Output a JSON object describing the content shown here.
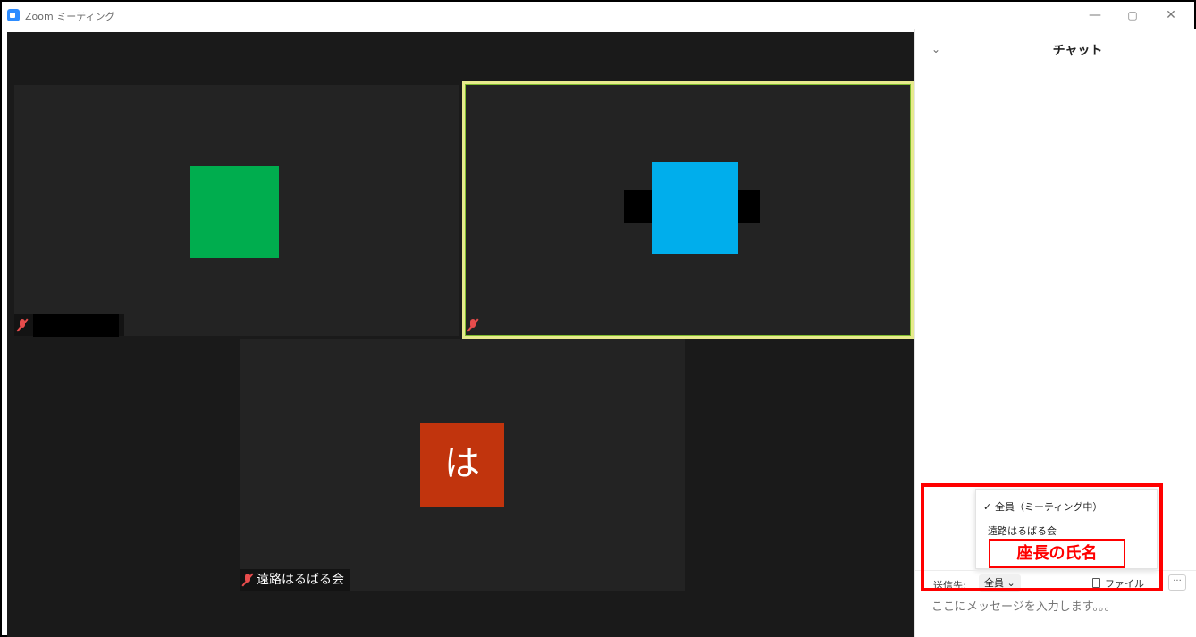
{
  "window": {
    "title": "Zoom ミーティング",
    "minimize_glyph": "—",
    "maximize_glyph": "▢",
    "close_glyph": "✕"
  },
  "participants": [
    {
      "avatar_color": "#00ad4e",
      "name_redacted": true
    },
    {
      "avatar_color": "#00aeec",
      "active_speaker": true
    },
    {
      "avatar_color": "#c1340d",
      "avatar_text": "は",
      "name": "遠路はるばる会"
    }
  ],
  "chat": {
    "collapse_glyph": "⌄",
    "title": "チャット",
    "dropdown": {
      "options": [
        {
          "label": "全員（ミーティング中）",
          "checked": true
        },
        {
          "label": "遠路はるばる会",
          "checked": false
        }
      ],
      "check_glyph": "✓"
    },
    "annotation": "座長の氏名",
    "send_to_label": "送信先:",
    "recipient": "全員 ⌄",
    "file_label": "ファイル",
    "more_glyph": "···",
    "message_placeholder": "ここにメッセージを入力します。。。"
  },
  "colors": {
    "highlight": "#ff0000",
    "active_speaker_border": "#e7ea8d",
    "muted_mic": "#e74c4c"
  }
}
